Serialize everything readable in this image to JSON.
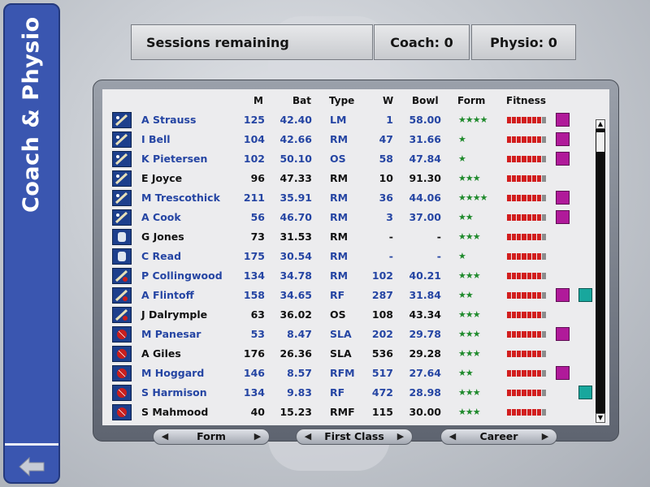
{
  "sidebar": {
    "title": "Coach & Physio",
    "back_icon": "back-arrow-icon"
  },
  "header": {
    "sessions_label": "Sessions remaining",
    "coach_label": "Coach: 0",
    "physio_label": "Physio: 0"
  },
  "table": {
    "columns": [
      "M",
      "Bat",
      "Type",
      "W",
      "Bowl",
      "Form",
      "Fitness"
    ],
    "rows": [
      {
        "name": "A Strauss",
        "m": "125",
        "bat": "42.40",
        "type": "LM",
        "w": "1",
        "bowl": "58.00",
        "form": 4,
        "fitness": 7,
        "icon": "bat-icon",
        "coach": true,
        "physio": false,
        "blue": true
      },
      {
        "name": "I Bell",
        "m": "104",
        "bat": "42.66",
        "type": "RM",
        "w": "47",
        "bowl": "31.66",
        "form": 1,
        "fitness": 7,
        "icon": "bat-icon",
        "coach": true,
        "physio": false,
        "blue": true
      },
      {
        "name": "K Pietersen",
        "m": "102",
        "bat": "50.10",
        "type": "OS",
        "w": "58",
        "bowl": "47.84",
        "form": 1,
        "fitness": 7,
        "icon": "bat-icon",
        "coach": true,
        "physio": false,
        "blue": true
      },
      {
        "name": "E Joyce",
        "m": "96",
        "bat": "47.33",
        "type": "RM",
        "w": "10",
        "bowl": "91.30",
        "form": 3,
        "fitness": 7,
        "icon": "bat-icon",
        "coach": false,
        "physio": false,
        "blue": false
      },
      {
        "name": "M Trescothick",
        "m": "211",
        "bat": "35.91",
        "type": "RM",
        "w": "36",
        "bowl": "44.06",
        "form": 4,
        "fitness": 7,
        "icon": "bat-icon",
        "coach": true,
        "physio": false,
        "blue": true
      },
      {
        "name": "A Cook",
        "m": "56",
        "bat": "46.70",
        "type": "RM",
        "w": "3",
        "bowl": "37.00",
        "form": 2,
        "fitness": 7,
        "icon": "bat-icon",
        "coach": true,
        "physio": false,
        "blue": true
      },
      {
        "name": "G Jones",
        "m": "73",
        "bat": "31.53",
        "type": "RM",
        "w": "-",
        "bowl": "-",
        "form": 3,
        "fitness": 7,
        "icon": "gloves-icon",
        "coach": false,
        "physio": false,
        "blue": false
      },
      {
        "name": "C Read",
        "m": "175",
        "bat": "30.54",
        "type": "RM",
        "w": "-",
        "bowl": "-",
        "form": 1,
        "fitness": 7,
        "icon": "gloves-icon",
        "coach": false,
        "physio": false,
        "blue": true
      },
      {
        "name": "P Collingwood",
        "m": "134",
        "bat": "34.78",
        "type": "RM",
        "w": "102",
        "bowl": "40.21",
        "form": 3,
        "fitness": 7,
        "icon": "allrounder-icon",
        "coach": false,
        "physio": false,
        "blue": true
      },
      {
        "name": "A Flintoff",
        "m": "158",
        "bat": "34.65",
        "type": "RF",
        "w": "287",
        "bowl": "31.84",
        "form": 2,
        "fitness": 7,
        "icon": "allrounder-icon",
        "coach": true,
        "physio": true,
        "blue": true
      },
      {
        "name": "J Dalrymple",
        "m": "63",
        "bat": "36.02",
        "type": "OS",
        "w": "108",
        "bowl": "43.34",
        "form": 3,
        "fitness": 7,
        "icon": "allrounder-icon",
        "coach": false,
        "physio": false,
        "blue": false
      },
      {
        "name": "M Panesar",
        "m": "53",
        "bat": "8.47",
        "type": "SLA",
        "w": "202",
        "bowl": "29.78",
        "form": 3,
        "fitness": 7,
        "icon": "ball-icon",
        "coach": true,
        "physio": false,
        "blue": true
      },
      {
        "name": "A Giles",
        "m": "176",
        "bat": "26.36",
        "type": "SLA",
        "w": "536",
        "bowl": "29.28",
        "form": 3,
        "fitness": 7,
        "icon": "ball-icon",
        "coach": false,
        "physio": false,
        "blue": false
      },
      {
        "name": "M Hoggard",
        "m": "146",
        "bat": "8.57",
        "type": "RFM",
        "w": "517",
        "bowl": "27.64",
        "form": 2,
        "fitness": 7,
        "icon": "ball-icon",
        "coach": true,
        "physio": false,
        "blue": true
      },
      {
        "name": "S Harmison",
        "m": "134",
        "bat": "9.83",
        "type": "RF",
        "w": "472",
        "bowl": "28.98",
        "form": 3,
        "fitness": 7,
        "icon": "ball-icon",
        "coach": false,
        "physio": true,
        "blue": true
      },
      {
        "name": "S Mahmood",
        "m": "40",
        "bat": "15.23",
        "type": "RMF",
        "w": "115",
        "bowl": "30.00",
        "form": 3,
        "fitness": 7,
        "icon": "ball-icon",
        "coach": false,
        "physio": false,
        "blue": false
      }
    ]
  },
  "tabs": [
    {
      "label": "Form"
    },
    {
      "label": "First Class"
    },
    {
      "label": "Career"
    }
  ],
  "colors": {
    "sidebar": "#3a56b0",
    "name_blue": "#2545a3",
    "fitness_red": "#d21e1e",
    "coach_icon": "#b01a9a",
    "physio_icon": "#18a79d",
    "form_star": "#1f8a2c"
  }
}
